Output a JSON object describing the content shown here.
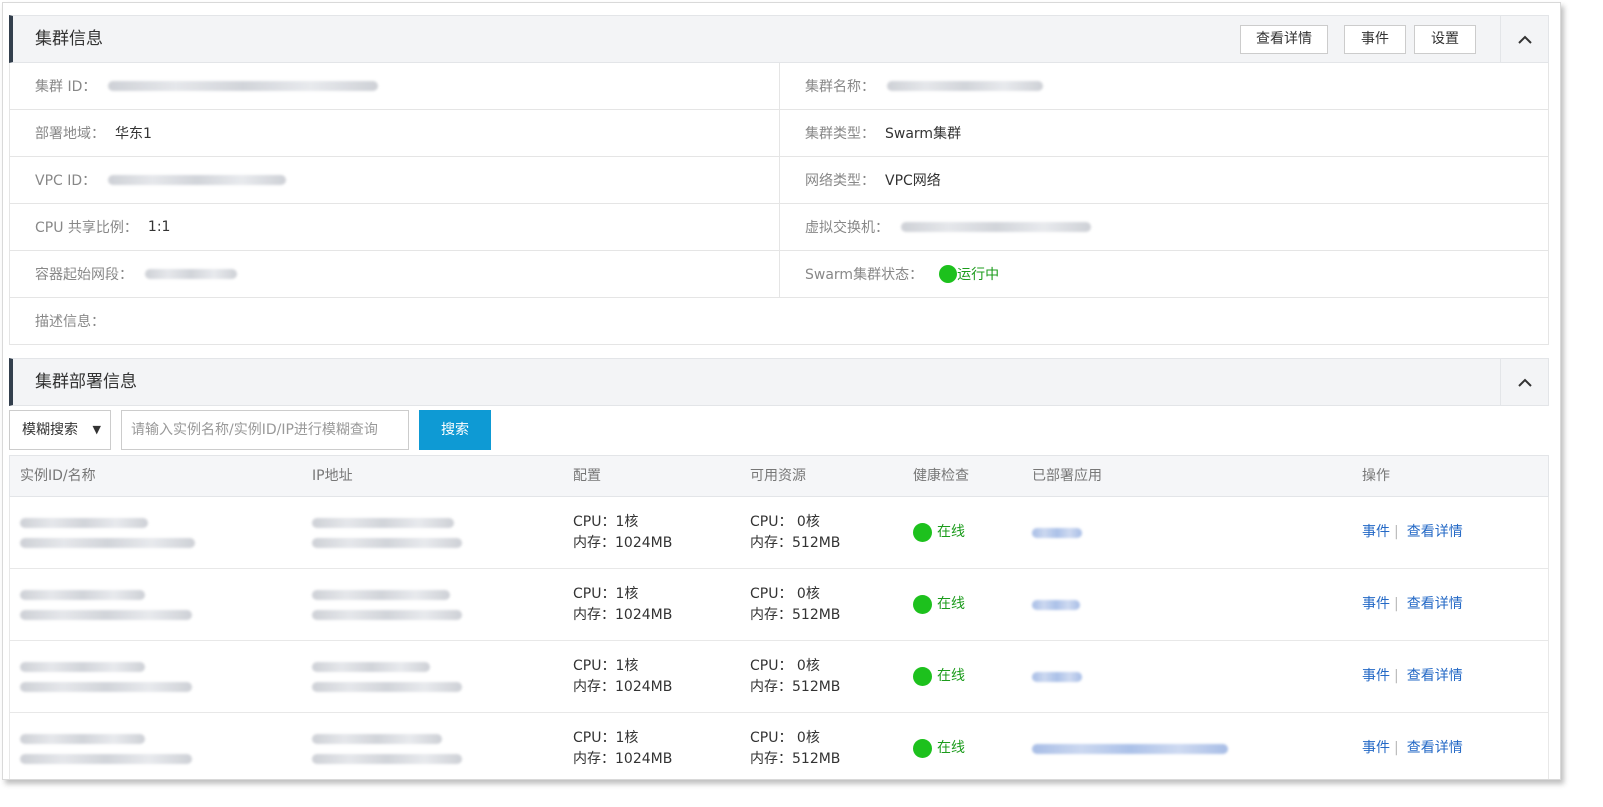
{
  "cluster_info": {
    "title": "集群信息",
    "buttons": {
      "details": "查看详情",
      "events": "事件",
      "settings": "设置"
    },
    "rows": [
      {
        "left_label": "集群 ID：",
        "left_value": "",
        "right_label": "集群名称：",
        "right_value": ""
      },
      {
        "left_label": "部署地域：",
        "left_value": "华东1",
        "right_label": "集群类型：",
        "right_value": "Swarm集群"
      },
      {
        "left_label": "VPC ID：",
        "left_value": "",
        "right_label": "网络类型：",
        "right_value": "VPC网络"
      },
      {
        "left_label": "CPU 共享比例：",
        "left_value": "1:1",
        "right_label": "虚拟交换机：",
        "right_value": ""
      },
      {
        "left_label": "容器起始网段：",
        "left_value": "",
        "right_label": "Swarm集群状态：",
        "right_value": "运行中"
      }
    ],
    "description_label": "描述信息："
  },
  "deploy_info": {
    "title": "集群部署信息",
    "filter": {
      "select_value": "模糊搜索",
      "search_placeholder": "请输入实例名称/实例ID/IP进行模糊查询",
      "search_button": "搜索"
    },
    "columns": [
      "实例ID/名称",
      "IP地址",
      "配置",
      "可用资源",
      "健康检查",
      "已部署应用",
      "操作"
    ],
    "rows": [
      {
        "config_cpu": "CPU：1核",
        "config_mem": "内存：1024MB",
        "avail_cpu": "CPU： 0核",
        "avail_mem": "内存：512MB",
        "health": "在线",
        "op_events": "事件",
        "op_details": "查看详情"
      },
      {
        "config_cpu": "CPU：1核",
        "config_mem": "内存：1024MB",
        "avail_cpu": "CPU： 0核",
        "avail_mem": "内存：512MB",
        "health": "在线",
        "op_events": "事件",
        "op_details": "查看详情"
      },
      {
        "config_cpu": "CPU：1核",
        "config_mem": "内存：1024MB",
        "avail_cpu": "CPU： 0核",
        "avail_mem": "内存：512MB",
        "health": "在线",
        "op_events": "事件",
        "op_details": "查看详情"
      },
      {
        "config_cpu": "CPU：1核",
        "config_mem": "内存：1024MB",
        "avail_cpu": "CPU： 0核",
        "avail_mem": "内存：512MB",
        "health": "在线",
        "op_events": "事件",
        "op_details": "查看详情"
      }
    ]
  },
  "icons": {
    "collapse": "chevron-up-icon",
    "status": "status-dot-icon",
    "dropdown": "caret-down-icon"
  },
  "colors": {
    "online": "#1dc11d",
    "primary_button": "#0e9ad4",
    "link": "#2469c6",
    "section_accent": "#333f4d"
  }
}
